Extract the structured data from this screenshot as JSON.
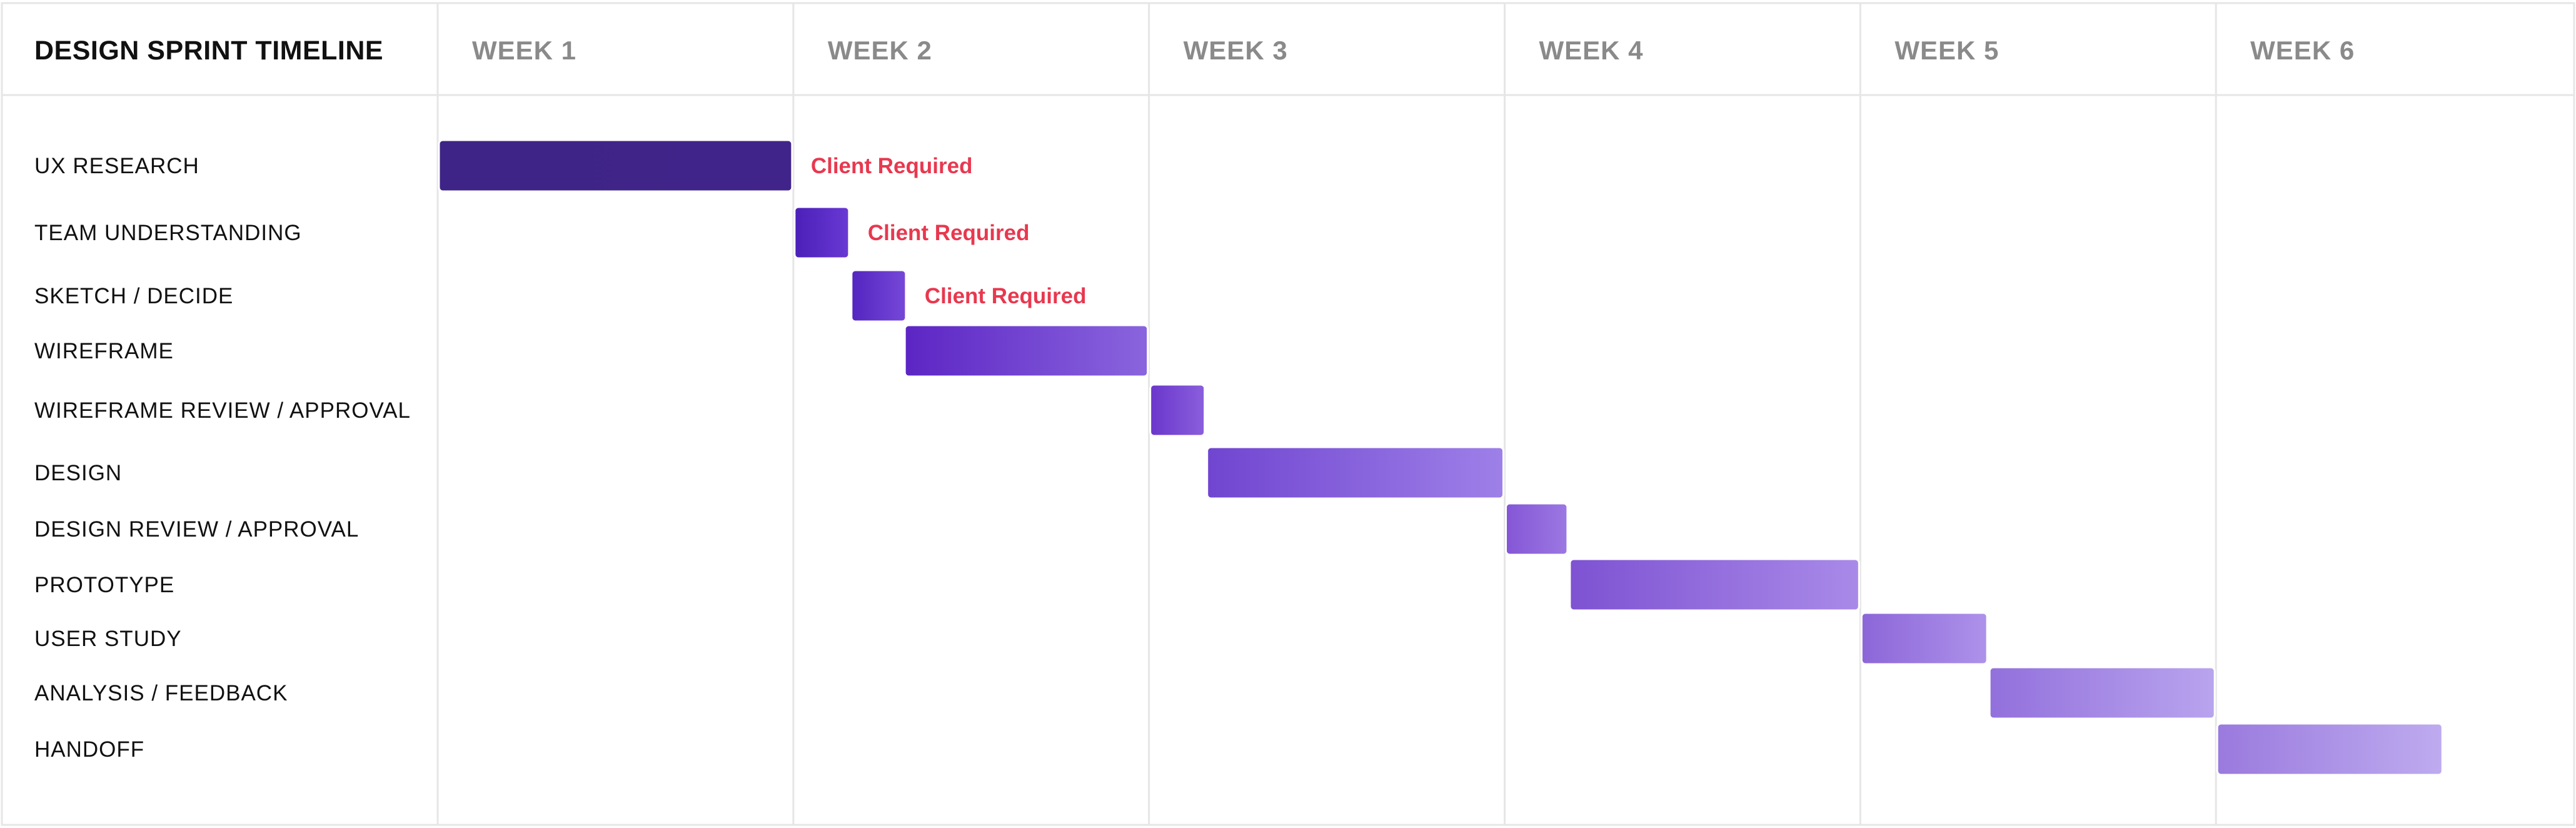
{
  "chart_data": {
    "type": "gantt",
    "title": "DESIGN SPRINT TIMELINE",
    "x_unit": "weeks",
    "xlim": [
      0,
      6
    ],
    "columns": [
      "WEEK 1",
      "WEEK 2",
      "WEEK 3",
      "WEEK 4",
      "WEEK 5",
      "WEEK 6"
    ],
    "tasks": [
      {
        "name": "UX RESEARCH",
        "start": 0.0,
        "end": 1.0,
        "annotation": "Client Required"
      },
      {
        "name": "TEAM UNDERSTANDING",
        "start": 1.0,
        "end": 1.16,
        "annotation": "Client Required"
      },
      {
        "name": "SKETCH / DECIDE",
        "start": 1.16,
        "end": 1.32,
        "annotation": "Client Required"
      },
      {
        "name": "WIREFRAME",
        "start": 1.31,
        "end": 2.0,
        "annotation": ""
      },
      {
        "name": "WIREFRAME REVIEW / APPROVAL",
        "start": 2.0,
        "end": 2.16,
        "annotation": ""
      },
      {
        "name": "DESIGN",
        "start": 2.16,
        "end": 3.0,
        "annotation": ""
      },
      {
        "name": "DESIGN REVIEW / APPROVAL",
        "start": 3.0,
        "end": 3.18,
        "annotation": ""
      },
      {
        "name": "PROTOTYPE",
        "start": 3.18,
        "end": 4.0,
        "annotation": ""
      },
      {
        "name": "USER STUDY",
        "start": 4.0,
        "end": 4.36,
        "annotation": ""
      },
      {
        "name": "ANALYSIS / FEEDBACK",
        "start": 4.36,
        "end": 5.0,
        "annotation": ""
      },
      {
        "name": "HANDOFF",
        "start": 5.0,
        "end": 5.64,
        "annotation": ""
      }
    ],
    "grid": true,
    "legend": "none"
  },
  "colors": {
    "annotation_text": "#e8384f",
    "title_text": "#111111",
    "week_label_text": "#8a8a8a",
    "grid": "#e6e6e6",
    "bar_gradients": [
      [
        "#3e2486",
        "#41248a"
      ],
      [
        "#4a1fb8",
        "#6a39d4"
      ],
      [
        "#5425c0",
        "#7648d8"
      ],
      [
        "#5c25c4",
        "#8a65de"
      ],
      [
        "#6a36cc",
        "#8a5fdc"
      ],
      [
        "#7045d0",
        "#9e80e8"
      ],
      [
        "#8456d6",
        "#9c78e2"
      ],
      [
        "#7e52d2",
        "#a98ae8"
      ],
      [
        "#8c66d8",
        "#ad92ea"
      ],
      [
        "#9270dc",
        "#b9a4ee"
      ],
      [
        "#9a7ade",
        "#beabef"
      ]
    ]
  }
}
